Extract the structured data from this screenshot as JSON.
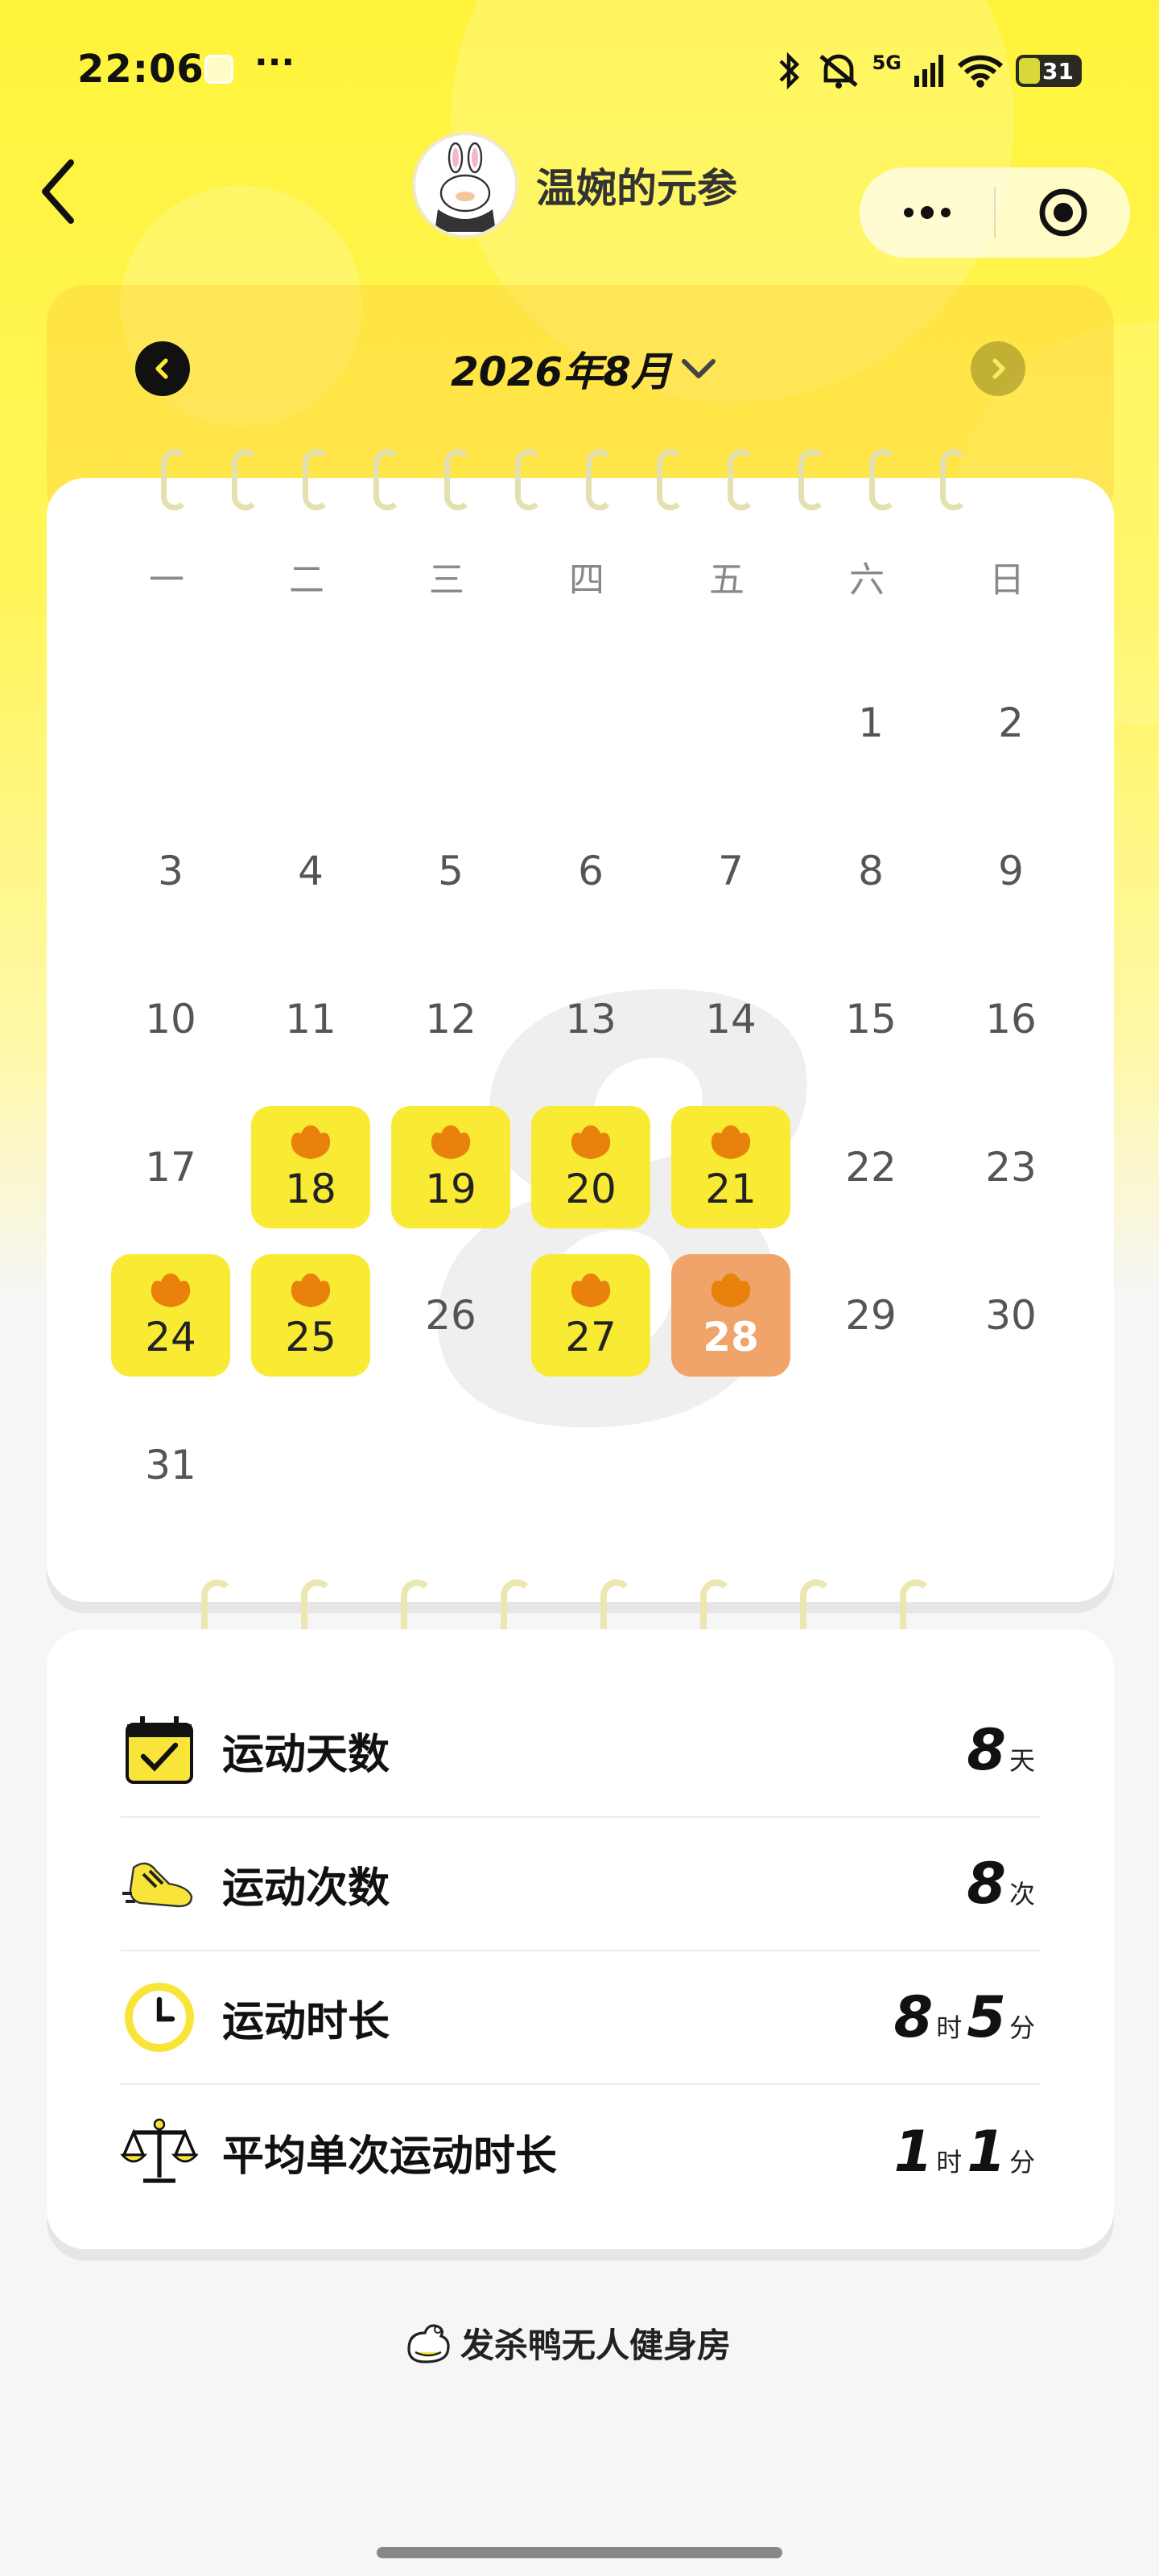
{
  "status": {
    "time": "22:06",
    "more": "···",
    "network": "5G",
    "battery": "31"
  },
  "header": {
    "title": "温婉的元参"
  },
  "calendar": {
    "month_label": "2026年8月",
    "weekdays": [
      "一",
      "二",
      "三",
      "四",
      "五",
      "六",
      "日"
    ],
    "watermark": "8",
    "weeks": [
      [
        null,
        null,
        null,
        null,
        null,
        {
          "d": "1",
          "s": "plain"
        },
        {
          "d": "2",
          "s": "plain"
        }
      ],
      [
        {
          "d": "3",
          "s": "plain"
        },
        {
          "d": "4",
          "s": "plain"
        },
        {
          "d": "5",
          "s": "plain"
        },
        {
          "d": "6",
          "s": "plain"
        },
        {
          "d": "7",
          "s": "plain"
        },
        {
          "d": "8",
          "s": "plain"
        },
        {
          "d": "9",
          "s": "plain"
        }
      ],
      [
        {
          "d": "10",
          "s": "plain"
        },
        {
          "d": "11",
          "s": "plain"
        },
        {
          "d": "12",
          "s": "plain"
        },
        {
          "d": "13",
          "s": "plain"
        },
        {
          "d": "14",
          "s": "plain"
        },
        {
          "d": "15",
          "s": "plain"
        },
        {
          "d": "16",
          "s": "plain"
        }
      ],
      [
        {
          "d": "17",
          "s": "plain"
        },
        {
          "d": "18",
          "s": "active"
        },
        {
          "d": "19",
          "s": "active"
        },
        {
          "d": "20",
          "s": "active"
        },
        {
          "d": "21",
          "s": "active"
        },
        {
          "d": "22",
          "s": "plain"
        },
        {
          "d": "23",
          "s": "plain"
        }
      ],
      [
        {
          "d": "24",
          "s": "active"
        },
        {
          "d": "25",
          "s": "active"
        },
        {
          "d": "26",
          "s": "plain"
        },
        {
          "d": "27",
          "s": "active"
        },
        {
          "d": "28",
          "s": "today"
        },
        {
          "d": "29",
          "s": "plain"
        },
        {
          "d": "30",
          "s": "plain"
        }
      ],
      [
        {
          "d": "31",
          "s": "plain"
        },
        null,
        null,
        null,
        null,
        null,
        null
      ]
    ]
  },
  "stats": {
    "days": {
      "label": "运动天数",
      "value": "8",
      "unit": "天"
    },
    "times": {
      "label": "运动次数",
      "value": "8",
      "unit": "次"
    },
    "duration": {
      "label": "运动时长",
      "hours": "8",
      "hour_unit": "时",
      "minutes": "5",
      "minute_unit": "分"
    },
    "average": {
      "label": "平均单次运动时长",
      "hours": "1",
      "hour_unit": "时",
      "minutes": "1",
      "minute_unit": "分"
    }
  },
  "footer": {
    "brand": "发杀鸭无人健身房"
  },
  "colors": {
    "active_day": "#f9ea34",
    "today": "#f0a46a",
    "duck": "#e8820c",
    "bg_yellow": "#fff33a"
  }
}
